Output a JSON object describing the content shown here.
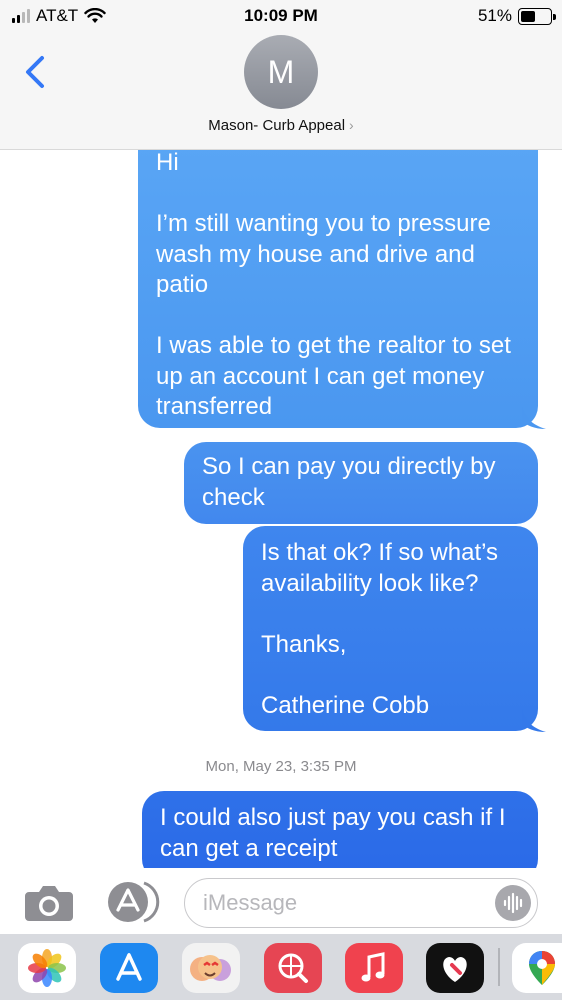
{
  "status_bar": {
    "carrier": "AT&T",
    "time": "10:09 PM",
    "battery_percent": "51%",
    "battery_level": 0.51
  },
  "header": {
    "avatar_initial": "M",
    "contact_name": "Mason- Curb Appeal",
    "chevron": "›"
  },
  "messages": [
    {
      "text": "Hi\n\nI’m still wanting you to pressure wash my house and drive and patio\n\nI was able to get the realtor to set up an account I can get money transferred"
    },
    {
      "text": "So I can pay you directly by check"
    },
    {
      "text": "Is that ok? If so what’s availability look like?\n\nThanks,\n\nCatherine Cobb"
    },
    {
      "text": "I could also just pay you cash if I can get a receipt"
    }
  ],
  "timestamp": {
    "day": "Mon, May 23,",
    "time": "3:35 PM"
  },
  "input": {
    "placeholder": "iMessage"
  },
  "icons": {
    "back": "chevron-left-icon",
    "camera": "camera-icon",
    "apps": "app-store-icon",
    "audio": "waveform-icon"
  },
  "colors": {
    "accent": "#3478f6",
    "bubble_top": "#5aa6f5",
    "bubble_bottom": "#2a69e7",
    "timestamp": "#8a8a8e"
  },
  "drawer_apps": [
    "photos-app-icon",
    "app-store-app-icon",
    "memoji-app-icon",
    "image-search-app-icon",
    "music-app-icon",
    "heart-app-icon",
    "maps-app-icon"
  ]
}
